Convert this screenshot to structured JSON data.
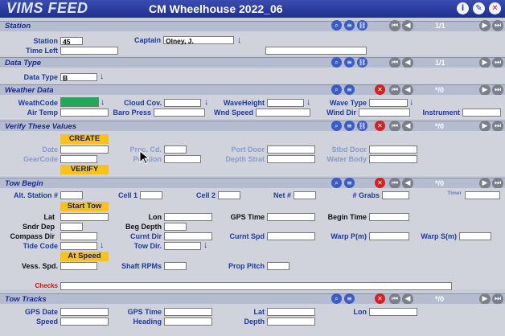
{
  "app": {
    "logo": "VIMS FEED",
    "title": "CM Wheelhouse 2022_06"
  },
  "titlebar_icons": [
    "info-icon",
    "edit-icon",
    "close-icon"
  ],
  "station": {
    "title": "Station",
    "station_label": "Station",
    "station_value": "45",
    "captain_label": "Captain",
    "captain_value": "Olney, J.",
    "time_left_label": "Time Left",
    "time_left_value": "",
    "page": "1/1"
  },
  "data_type": {
    "title": "Data Type",
    "label": "Data Type",
    "value": "B",
    "page": "1/1"
  },
  "weather": {
    "title": "Weather Data",
    "page": "*/0",
    "wcode_label": "WeathCode",
    "cloud_label": "Cloud Cov.",
    "wave_height_label": "WaveHeight",
    "wave_type_label": "Wave Type",
    "air_temp_label": "Air Temp",
    "baro_label": "Baro Press",
    "wind_speed_label": "Wnd Speed",
    "wind_dir_label": "Wind Dir",
    "instrument_label": "Instrument"
  },
  "verify": {
    "title": "Verify These Values",
    "page": "*/0",
    "create_label": "CREATE",
    "verify_label": "VERIFY",
    "date_label": "Date",
    "proc_label": "Proc. Cd.",
    "port_label": "Port Door",
    "stbd_label": "Stbd Door",
    "gearcode_label": "GearCode",
    "position_label": "Position",
    "depth_strat_label": "Depth Strat",
    "water_body_label": "Water Body"
  },
  "tow": {
    "title": "Tow Begin",
    "page": "*/0",
    "alt_station_label": "Alt. Station #",
    "cell1_label": "Cell 1",
    "cell2_label": "Cell 2",
    "net_label": "Net #",
    "grabs_label": "# Grabs",
    "timer_label": "Timer",
    "start_tow_label": "Start Tow",
    "lat_label": "Lat",
    "lon_label": "Lon",
    "gps_time_label": "GPS Time",
    "begin_time_label": "Begin Time",
    "sndr_dep_label": "Sndr Dep",
    "beg_depth_label": "Beg Depth",
    "compass_dir_label": "Compass Dir",
    "curnt_dir_label": "Curnt Dir",
    "curnt_spd_label": "Curnt Spd",
    "warp_p_label": "Warp P(m)",
    "warp_s_label": "Warp S(m)",
    "tide_code_label": "Tide Code",
    "tow_dir_label": "Tow Dir.",
    "at_speed_label": "At Speed",
    "vess_spd_label": "Vess. Spd.",
    "shaft_rpm_label": "Shaft RPMs",
    "prop_pitch_label": "Prop Pitch",
    "checks_label": "Checks"
  },
  "tracks": {
    "title": "Tow Tracks",
    "page": "*/0",
    "gps_date_label": "GPS Date",
    "gps_time_label": "GPS Time",
    "lat_label": "Lat",
    "lon_label": "Lon",
    "speed_label": "Speed",
    "heading_label": "Heading",
    "depth_label": "Depth"
  }
}
